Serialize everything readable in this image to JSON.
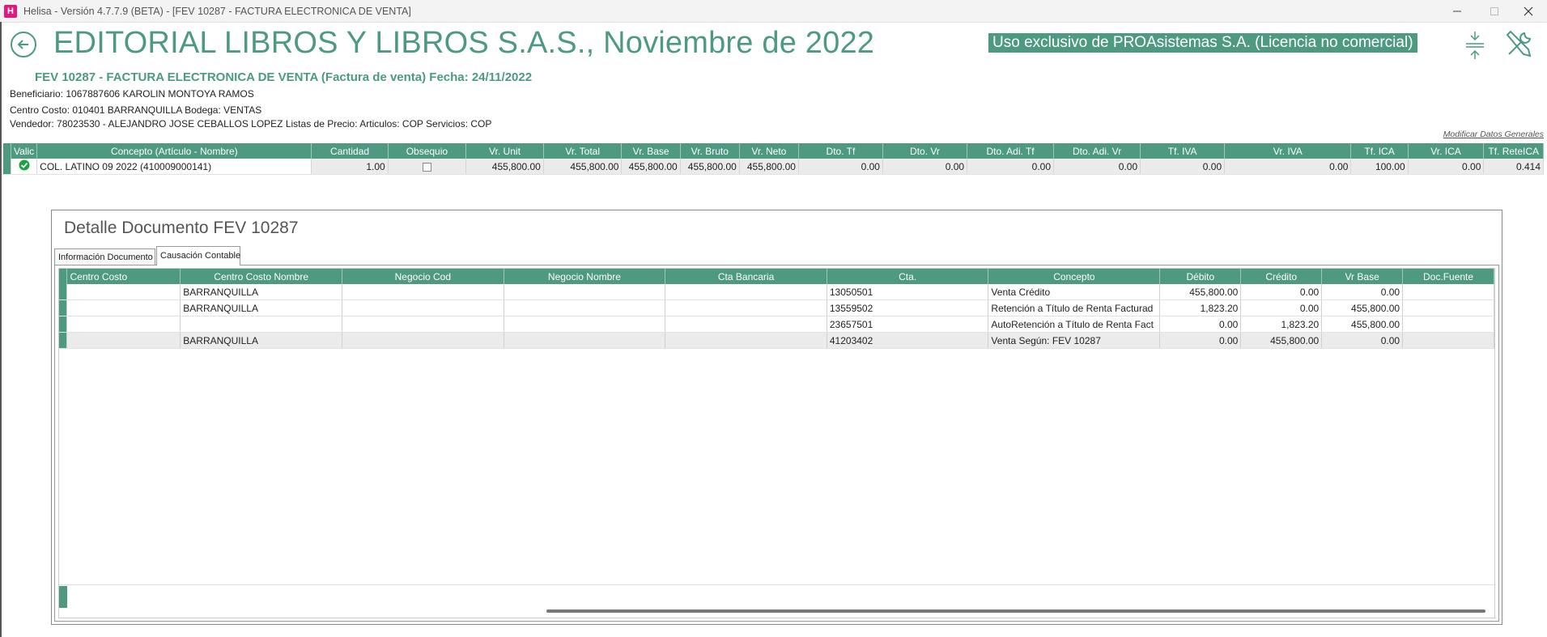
{
  "window": {
    "title": "Helisa - Versión 4.7.7.9 (BETA) - [FEV 10287 - FACTURA ELECTRONICA DE VENTA]",
    "app_icon_letter": "H"
  },
  "header": {
    "company_title": "EDITORIAL LIBROS Y LIBROS S.A.S., Noviembre de 2022",
    "license_label": "Uso exclusivo de PROAsistemas S.A. (Licencia no comercial)"
  },
  "document": {
    "title": "FEV 10287 - FACTURA ELECTRONICA DE VENTA (Factura de venta) Fecha: 24/11/2022",
    "beneficiario": "Beneficiario: 1067887606 KAROLIN MONTOYA RAMOS",
    "centro_bodega": "Centro Costo: 010401 BARRANQUILLA   Bodega: VENTAS",
    "vendedor": "Vendedor: 78023530 - ALEJANDRO JOSE CEBALLOS LOPEZ   Listas de Precio: Articulos: COP Servicios: COP",
    "modify_link": "Modificar Datos Generales"
  },
  "items_grid": {
    "columns": [
      "Valic",
      "Concepto (Artículo - Nombre)",
      "Cantidad",
      "Obsequio",
      "Vr. Unit",
      "Vr. Total",
      "Vr. Base",
      "Vr. Bruto",
      "Vr. Neto",
      "Dto. Tf",
      "Dto. Vr",
      "Dto. Adi. Tf",
      "Dto. Adi. Vr",
      "Tf. IVA",
      "Vr. IVA",
      "Tf. ICA",
      "Vr. ICA",
      "Tf. ReteICA"
    ],
    "rows": [
      [
        "",
        "COL. LATINO 09 2022 (410009000141)",
        "1.00",
        "",
        "455,800.00",
        "455,800.00",
        "455,800.00",
        "455,800.00",
        "455,800.00",
        "0.00",
        "0.00",
        "0.00",
        "0.00",
        "0.00",
        "0.00",
        "100.00",
        "0.00",
        "0.414"
      ]
    ]
  },
  "detail": {
    "title": "Detalle Documento FEV 10287",
    "tabs": [
      "Información Documento",
      "Causación Contable"
    ],
    "active_tab": "Causación Contable",
    "columns": [
      "Centro Costo",
      "Centro Costo Nombre",
      "Negocio Cod",
      "Negocio Nombre",
      "Cta Bancaria",
      "Cta.",
      "Concepto",
      "Débito",
      "Crédito",
      "Vr Base",
      "Doc.Fuente"
    ],
    "rows": [
      [
        "",
        "BARRANQUILLA",
        "",
        "",
        "",
        "13050501",
        "Venta Crédito",
        "455,800.00",
        "0.00",
        "0.00",
        ""
      ],
      [
        "",
        "BARRANQUILLA",
        "",
        "",
        "",
        "13559502",
        "Retención a Título de Renta Facturad",
        "1,823.20",
        "0.00",
        "455,800.00",
        ""
      ],
      [
        "",
        "",
        "",
        "",
        "",
        "23657501",
        "AutoRetención a Título de Renta Fact",
        "0.00",
        "1,823.20",
        "455,800.00",
        ""
      ],
      [
        "",
        "BARRANQUILLA",
        "",
        "",
        "",
        "41203402",
        "Venta Según: FEV 10287",
        "0.00",
        "455,800.00",
        "0.00",
        ""
      ]
    ]
  },
  "icons": {
    "back": "back-arrow-icon",
    "compress": "compress-icon",
    "tools": "tools-icon",
    "valid": "check-circle-icon"
  },
  "colors": {
    "accent": "#4d9a80",
    "valid": "#1aa340",
    "app_icon": "#e0197d"
  }
}
